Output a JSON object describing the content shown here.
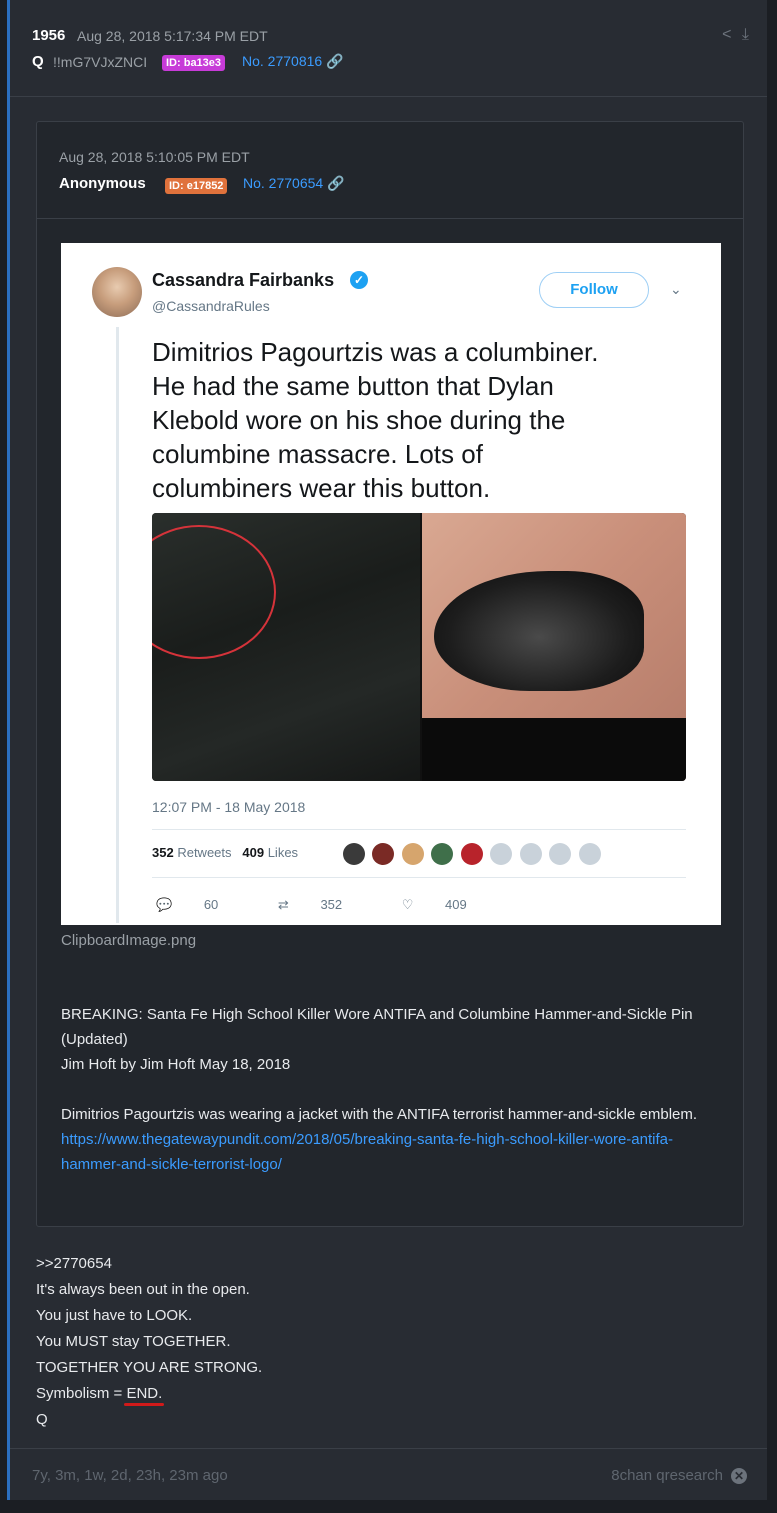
{
  "post": {
    "number": "1956",
    "date": "Aug 28, 2018 5:17:34 PM EDT",
    "author": "Q",
    "tripcode": "!!mG7VJxZNCI",
    "id_badge": "ID: ba13e3",
    "id_color": "#c73bd8",
    "post_no": "No. 2770816",
    "share_icon": "share-icon",
    "download_icon": "download-icon"
  },
  "quoted": {
    "date": "Aug 28, 2018 5:10:05 PM EDT",
    "author": "Anonymous",
    "id_badge": "ID: e17852",
    "id_color": "#e0723c",
    "post_no": "No. 2770654",
    "tweet": {
      "name": "Cassandra Fairbanks",
      "handle": "@CassandraRules",
      "follow_label": "Follow",
      "text": "Dimitrios Pagourtzis was a columbiner.\nHe had the same button that Dylan\nKlebold wore on his shoe during the\ncolumbine massacre. Lots of\ncolumbiners wear this button.",
      "time": "12:07 PM - 18 May 2018",
      "retweets_count": "352",
      "retweets_label": "Retweets",
      "likes_count": "409",
      "likes_label": "Likes",
      "reply_count": "60",
      "retweet_count": "352",
      "like_count": "409"
    },
    "filename": "ClipboardImage.png",
    "body": {
      "headline": "BREAKING: Santa Fe High School Killer Wore ANTIFA and Columbine Hammer-and-Sickle Pin (Updated)",
      "byline": "Jim Hoft by Jim Hoft May 18, 2018",
      "paragraph": "Dimitrios Pagourtzis was wearing a jacket with the ANTIFA terrorist hammer-and-sickle emblem.",
      "link": "https://www.thegatewaypundit.com/2018/05/breaking-santa-fe-high-school-killer-wore-antifa-hammer-and-sickle-terrorist-logo/"
    }
  },
  "reply": {
    "ref": ">>2770654",
    "line1": "It's always been out in the open.",
    "line2": "You just have to LOOK.",
    "line3": "You MUST stay TOGETHER.",
    "line4": "TOGETHER YOU ARE STRONG.",
    "line5_prefix": "Symbolism = ",
    "line5_end": "END.",
    "signature": "Q"
  },
  "footer": {
    "ago": "7y, 3m, 1w, 2d, 23h, 23m ago",
    "source": "8chan qresearch"
  }
}
